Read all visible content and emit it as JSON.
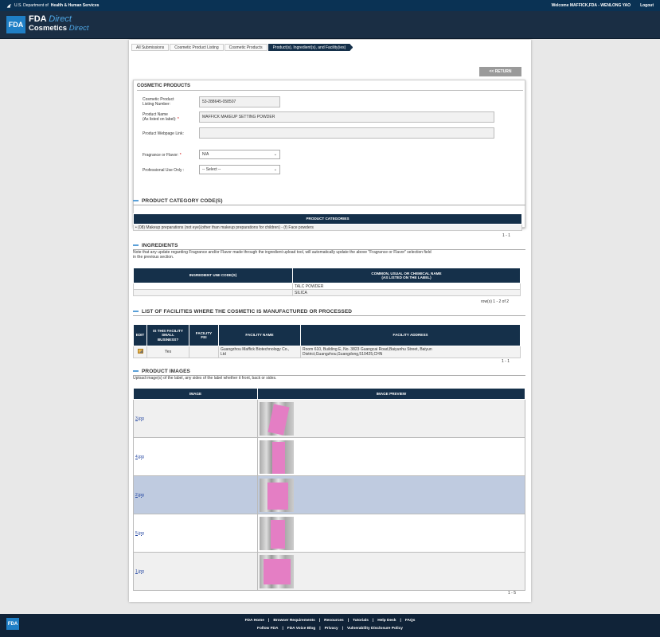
{
  "topbar": {
    "hhs_prefix": "U.S. Department of",
    "hhs_bold": "Health & Human Services",
    "welcome": "Welcome MAFFICK,FDA - WENLONG YAO",
    "logout": "Logout"
  },
  "brand": {
    "logo": "FDA",
    "line1a": "FDA",
    "line1b": "Direct",
    "line2a": "Cosmetics",
    "line2b": "Direct"
  },
  "breadcrumbs": [
    "All Submissions",
    "Cosmetic Product Listing",
    "Cosmetic Products",
    "Product(s), Ingredient(s), and Facility(ies)"
  ],
  "return_label": "<< RETURN",
  "cosmetic": {
    "title": "COSMETIC PRODUCTS",
    "listing_label_1": "Cosmetic Product",
    "listing_label_2": "Listing Number:",
    "listing_value": "53-288645-058507",
    "name_label_1": "Product Name",
    "name_label_2": "(As listed on label):",
    "req": "*",
    "name_value": "MAFFICK MAKEUP SETTING POWDER",
    "webpage_label": "Product Webpage Link:",
    "webpage_value": "",
    "fragrance_label": "Fragrance or Flavor:",
    "fragrance_value": "N/A",
    "professional_label": "Professional Use Only :",
    "professional_value": "-- Select --"
  },
  "category": {
    "title": "PRODUCT CATEGORY CODE(S)",
    "header": "PRODUCT CATEGORIES",
    "bullet": "•",
    "row": "(08) Makeup preparations (not eye)(other than makeup preparations for children) - (f) Face powders",
    "pager": "1 - 1"
  },
  "ingredients": {
    "title": "INGREDIENTS",
    "note_1": "Note that any update regarding Fragrance and/or Flavor made through the ingredient upload tool, will automatically update the above \"Fragrance or Flavor\" selection field",
    "note_2": "in the previous section.",
    "col1": "INGREDIENT UNII CODE(S)",
    "col2_1": "COMMON, USUAL OR CHEMICAL NAME",
    "col2_2": "(AS LISTED ON THE LABEL)",
    "rows": [
      [
        "",
        "TALC POWDER"
      ],
      [
        "",
        "SILICA"
      ]
    ],
    "pager": "row(s) 1 - 2 of 2"
  },
  "facilities": {
    "title": "LIST OF FACILITIES WHERE THE COSMETIC IS MANUFACTURED OR PROCESSED",
    "col_edit": "EDIT",
    "col_small_1": "IS THIS FACILITY",
    "col_small_2": "SMALL",
    "col_small_3": "BUSINESS?",
    "col_fei_1": "FACILITY",
    "col_fei_2": "FEI",
    "col_name": "FACILITY NAME",
    "col_address": "FACILITY ADDRESS",
    "row": {
      "small": "Yes",
      "fei": "",
      "name_1": "Guangzhou Maffick Biotechnology Co.,",
      "name_2": "Ltd",
      "address_1": "Room 610, Building E, No. 3823 Guangcai Road,Baiyunhu Street, Baiyun",
      "address_2": "District,Guangzhou,Guangdong,510425,CHN"
    },
    "pager": "1 - 1"
  },
  "images": {
    "title": "PRODUCT IMAGES",
    "note": "Upload image(s) of the label, any sides of the label whether it front, back or sides.",
    "col_image": "IMAGE",
    "col_preview": "IMAGE PREVIEW",
    "rows": [
      {
        "file": "3.jpg",
        "highlight": false
      },
      {
        "file": "4.jpg",
        "highlight": false
      },
      {
        "file": "2.jpg",
        "highlight": true
      },
      {
        "file": "5.jpg",
        "highlight": false
      },
      {
        "file": "1.jpg",
        "highlight": false
      }
    ],
    "pager": "1 - 5"
  },
  "footer": {
    "logo": "FDA",
    "sep": "|",
    "links_row1": [
      "FDA Home",
      "Browser Requirements",
      "Resources",
      "Tutorials",
      "Help Desk",
      "FAQs"
    ],
    "links_row2": [
      "Follow FDA",
      "FDA Voice Blog",
      "Privacy",
      "Vulnerability Disclosure Policy"
    ]
  },
  "colors": {
    "navy": "#15304a",
    "header": "#1a2e44",
    "highlight": "#bfcbe0",
    "pink": "#e47ec4"
  }
}
